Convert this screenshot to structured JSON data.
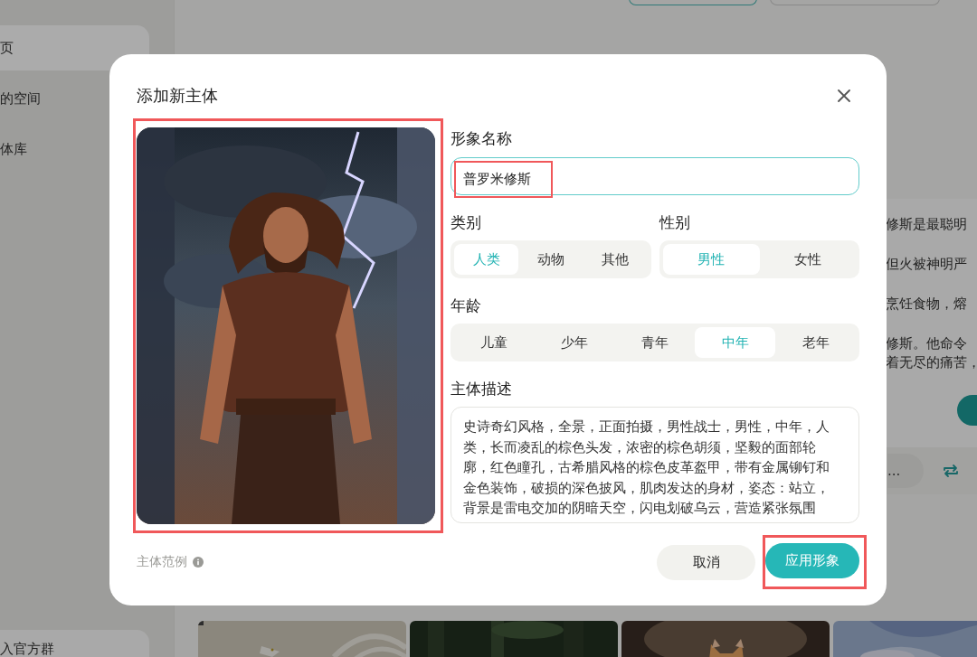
{
  "sidebar": {
    "items": [
      {
        "label": "页",
        "selected": true
      },
      {
        "label": "的空间",
        "selected": false
      },
      {
        "label": "体库",
        "selected": false
      }
    ],
    "footer_item": "入官方群"
  },
  "story": {
    "lines": [
      "修斯是最聪明",
      "但火被神明严",
      "烹饪食物，熔",
      "修斯。他命令",
      "着无尽的痛苦，"
    ],
    "input_text": "...",
    "thumbnails": [
      {
        "kind": "picture"
      },
      {
        "kind": "picture"
      },
      {
        "kind": "picture"
      },
      {
        "kind": "picture"
      }
    ]
  },
  "dialog": {
    "title": "添加新主体",
    "image": {
      "kind": "picture",
      "highlighted": true
    },
    "name": {
      "label": "形象名称",
      "value": "普罗米修斯",
      "highlighted": true
    },
    "category": {
      "label": "类别",
      "options": [
        {
          "label": "人类",
          "selected": true
        },
        {
          "label": "动物",
          "selected": false
        },
        {
          "label": "其他",
          "selected": false
        }
      ]
    },
    "gender": {
      "label": "性别",
      "options": [
        {
          "label": "男性",
          "selected": true
        },
        {
          "label": "女性",
          "selected": false
        }
      ]
    },
    "age": {
      "label": "年龄",
      "options": [
        {
          "label": "儿童",
          "selected": false
        },
        {
          "label": "少年",
          "selected": false
        },
        {
          "label": "青年",
          "selected": false
        },
        {
          "label": "中年",
          "selected": true
        },
        {
          "label": "老年",
          "selected": false
        }
      ]
    },
    "description": {
      "label": "主体描述",
      "text": "史诗奇幻风格，全景，正面拍摄，男性战士，男性，中年，人类，长而凌乱的棕色头发，浓密的棕色胡须，坚毅的面部轮廓，红色瞳孔，古希腊风格的棕色皮革盔甲，带有金属铆钉和金色装饰，破损的深色披风，肌肉发达的身材，姿态：站立，背景是雷电交加的阴暗天空，闪电划破乌云，营造紧张氛围"
    },
    "example_label": "主体范例",
    "buttons": [
      {
        "label": "取消",
        "kind": "secondary",
        "highlighted": false
      },
      {
        "label": "应用形象",
        "kind": "primary",
        "highlighted": true
      }
    ]
  }
}
